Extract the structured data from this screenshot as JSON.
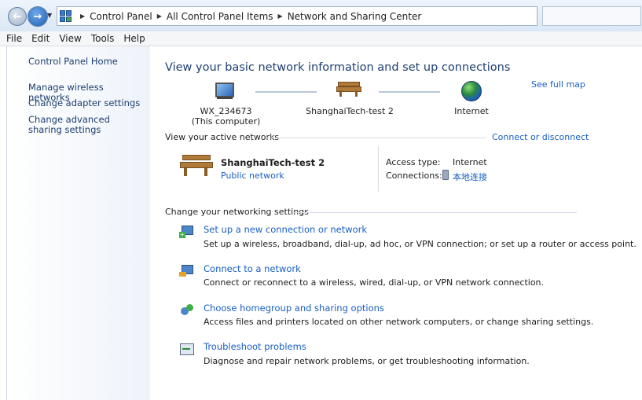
{
  "address_bar": {
    "breadcrumbs": [
      "Control Panel",
      "All Control Panel Items",
      "Network and Sharing Center"
    ]
  },
  "menu": [
    "File",
    "Edit",
    "View",
    "Tools",
    "Help"
  ],
  "sidebar": {
    "home": "Control Panel Home",
    "items": [
      "Manage wireless networks",
      "Change adapter settings",
      "Change advanced sharing settings"
    ]
  },
  "main": {
    "title": "View your basic network information and set up connections",
    "see_full_map": "See full map",
    "map": {
      "computer_name": "WX_234673",
      "computer_sub": "(This computer)",
      "network_name": "ShanghaiTech-test  2",
      "internet": "Internet"
    },
    "active_header": "View your active networks",
    "connect_disconnect": "Connect or disconnect",
    "active": {
      "name": "ShanghaiTech-test  2",
      "type_link": "Public network",
      "access_label": "Access type:",
      "access_value": "Internet",
      "connections_label": "Connections:",
      "connections_value": "本地连接"
    },
    "change_header": "Change your networking settings",
    "tasks": [
      {
        "title": "Set up a new connection or network",
        "desc": "Set up a wireless, broadband, dial-up, ad hoc, or VPN connection; or set up a router or access point.",
        "icon": "new-connection-icon"
      },
      {
        "title": "Connect to a network",
        "desc": "Connect or reconnect to a wireless, wired, dial-up, or VPN network connection.",
        "icon": "connect-network-icon"
      },
      {
        "title": "Choose homegroup and sharing options",
        "desc": "Access files and printers located on other network computers, or change sharing settings.",
        "icon": "homegroup-icon"
      },
      {
        "title": "Troubleshoot problems",
        "desc": "Diagnose and repair network problems, or get troubleshooting information.",
        "icon": "troubleshoot-icon"
      }
    ]
  }
}
